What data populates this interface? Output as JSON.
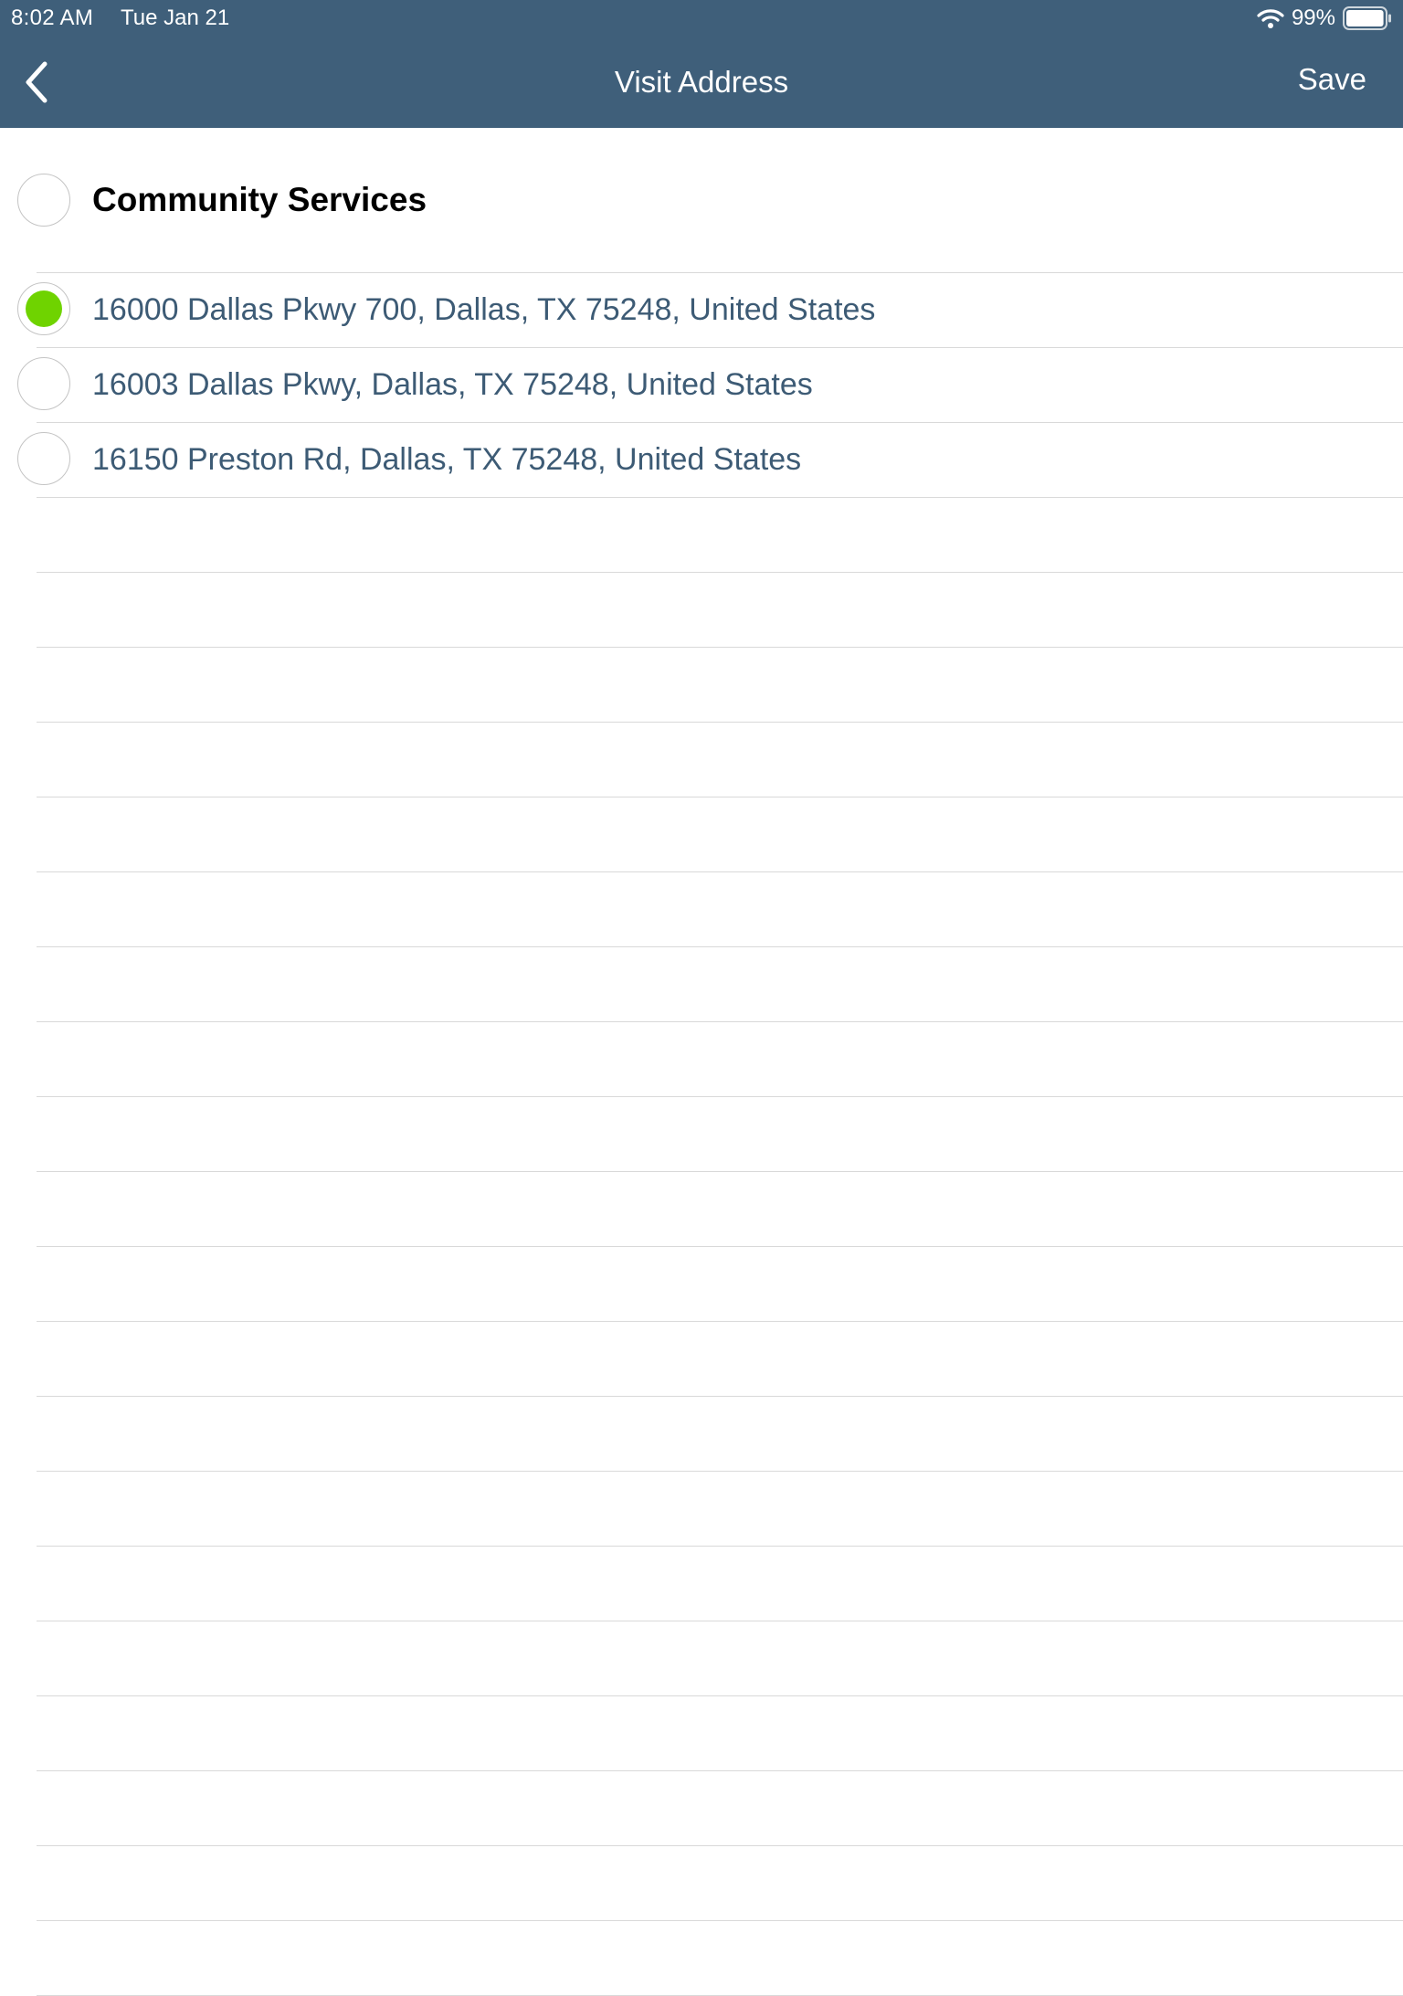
{
  "status_bar": {
    "time": "8:02 AM",
    "date": "Tue Jan 21",
    "battery": "99%",
    "battery_level": 0.99
  },
  "nav": {
    "title": "Visit Address",
    "save_label": "Save",
    "back_icon": "chevron-left-icon"
  },
  "group": {
    "label": "Community Services",
    "selected": false
  },
  "addresses": [
    {
      "label": "16000 Dallas Pkwy 700, Dallas, TX 75248, United States",
      "selected": true
    },
    {
      "label": "16003 Dallas Pkwy, Dallas, TX 75248, United States",
      "selected": false
    },
    {
      "label": "16150 Preston Rd, Dallas, TX 75248, United States",
      "selected": false
    }
  ],
  "colors": {
    "header_bg": "#3f5f7a",
    "selected_radio": "#6fd300",
    "address_text": "#3d5b75"
  }
}
